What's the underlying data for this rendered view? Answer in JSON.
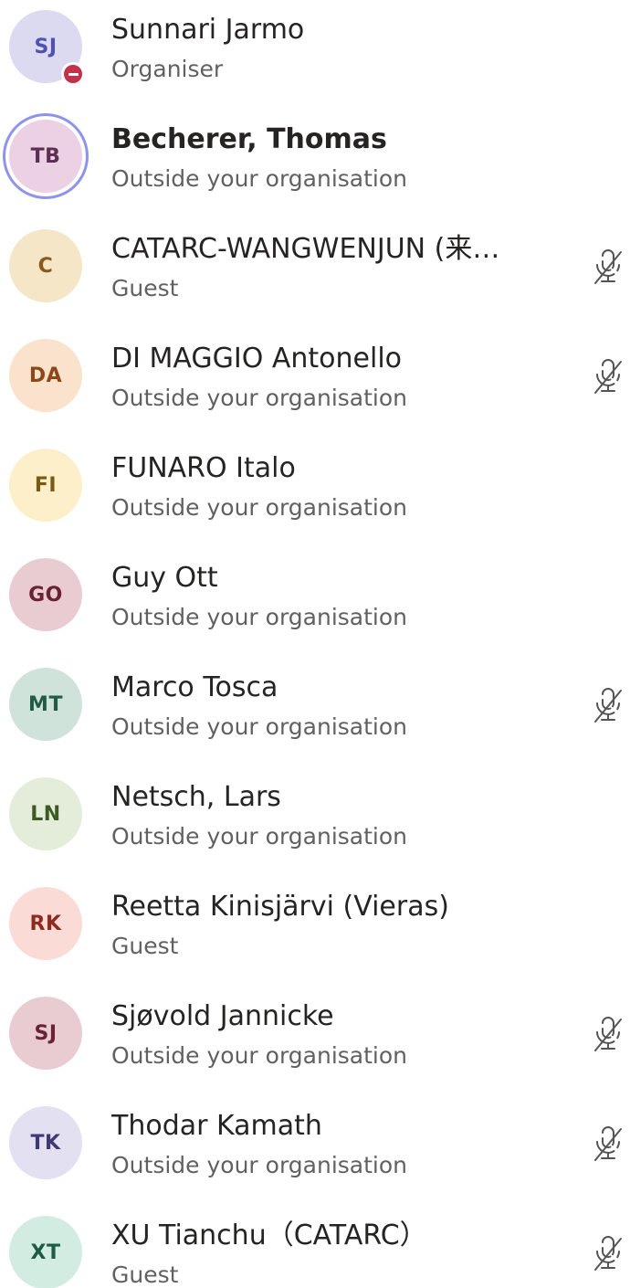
{
  "participants": [
    {
      "initials": "SJ",
      "name": "Sunnari Jarmo",
      "role": "Organiser",
      "avatar_bg": "#dcdaf0",
      "avatar_fg": "#4f52b2",
      "presence": "do-not-disturb",
      "muted": false,
      "speaking": false,
      "bold": false
    },
    {
      "initials": "TB",
      "name": "Becherer, Thomas",
      "role": "Outside your organisation",
      "avatar_bg": "#ecd1e4",
      "avatar_fg": "#5c2e53",
      "presence": "",
      "muted": false,
      "speaking": true,
      "bold": true
    },
    {
      "initials": "C",
      "name": "CATARC-WANGWENJUN (来…",
      "role": "Guest",
      "avatar_bg": "#f5e6c8",
      "avatar_fg": "#8a5a1c",
      "presence": "",
      "muted": true,
      "speaking": false,
      "bold": false
    },
    {
      "initials": "DA",
      "name": "DI MAGGIO Antonello",
      "role": "Outside your organisation",
      "avatar_bg": "#fbe2cd",
      "avatar_fg": "#8e4718",
      "presence": "",
      "muted": true,
      "speaking": false,
      "bold": false
    },
    {
      "initials": "FI",
      "name": "FUNARO Italo",
      "role": "Outside your organisation",
      "avatar_bg": "#fcefc9",
      "avatar_fg": "#7a5a12",
      "presence": "",
      "muted": false,
      "speaking": false,
      "bold": false
    },
    {
      "initials": "GO",
      "name": "Guy Ott",
      "role": "Outside your organisation",
      "avatar_bg": "#e9ccd2",
      "avatar_fg": "#6b2233",
      "presence": "",
      "muted": false,
      "speaking": false,
      "bold": false
    },
    {
      "initials": "MT",
      "name": "Marco Tosca",
      "role": "Outside your organisation",
      "avatar_bg": "#cfe3da",
      "avatar_fg": "#1f5b45",
      "presence": "",
      "muted": true,
      "speaking": false,
      "bold": false
    },
    {
      "initials": "LN",
      "name": "Netsch, Lars",
      "role": "Outside your organisation",
      "avatar_bg": "#e4ecda",
      "avatar_fg": "#3e5a22",
      "presence": "",
      "muted": false,
      "speaking": false,
      "bold": false
    },
    {
      "initials": "RK",
      "name": "Reetta Kinisjärvi (Vieras)",
      "role": "Guest",
      "avatar_bg": "#fadbd6",
      "avatar_fg": "#8e2b1f",
      "presence": "",
      "muted": false,
      "speaking": false,
      "bold": false
    },
    {
      "initials": "SJ",
      "name": "Sjøvold Jannicke",
      "role": "Outside your organisation",
      "avatar_bg": "#e9ccd2",
      "avatar_fg": "#6b2233",
      "presence": "",
      "muted": true,
      "speaking": false,
      "bold": false
    },
    {
      "initials": "TK",
      "name": "Thodar Kamath",
      "role": "Outside your organisation",
      "avatar_bg": "#e3e0f1",
      "avatar_fg": "#3d3a75",
      "presence": "",
      "muted": true,
      "speaking": false,
      "bold": false
    },
    {
      "initials": "XT",
      "name": "XU Tianchu（CATARC）",
      "role": "Guest",
      "avatar_bg": "#d3ece1",
      "avatar_fg": "#1d5c42",
      "presence": "",
      "muted": true,
      "speaking": false,
      "bold": false
    }
  ],
  "icons": {
    "muted": "mic-off-icon",
    "presence_dnd": "do-not-disturb-icon"
  }
}
